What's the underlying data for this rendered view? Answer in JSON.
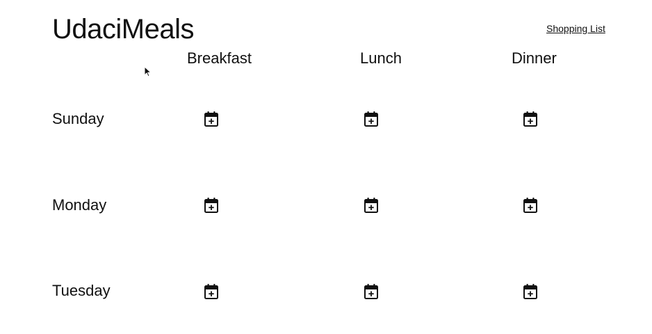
{
  "app": {
    "title": "UdaciMeals",
    "shopping_list_label": "Shopping List"
  },
  "meals": [
    "Breakfast",
    "Lunch",
    "Dinner"
  ],
  "days": [
    "Sunday",
    "Monday",
    "Tuesday"
  ],
  "slot_icon": "calendar-plus-icon"
}
